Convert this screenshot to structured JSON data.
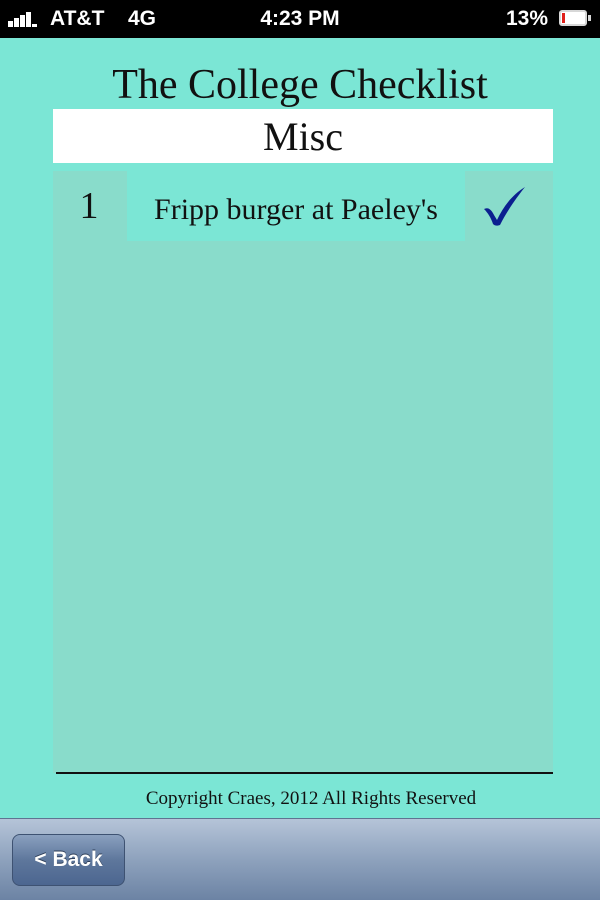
{
  "status_bar": {
    "carrier": "AT&T",
    "network": "4G",
    "time": "4:23 PM",
    "battery_percent": "13%",
    "battery_level": 0.13,
    "battery_color": "#e0201b",
    "signal_icon": "signal-bars-icon",
    "battery_icon": "battery-icon"
  },
  "app": {
    "title": "The College Checklist",
    "background_color": "#7be6d5"
  },
  "section": {
    "title": "Misc"
  },
  "items": [
    {
      "number": "1",
      "text": "Fripp burger at Paeley's",
      "checked": true,
      "check_icon": "checkmark-icon",
      "check_color": "#0b1f8f"
    }
  ],
  "footer": {
    "copyright": "Copyright Craes, 2012 All Rights Reserved"
  },
  "toolbar": {
    "back_label": "< Back"
  }
}
